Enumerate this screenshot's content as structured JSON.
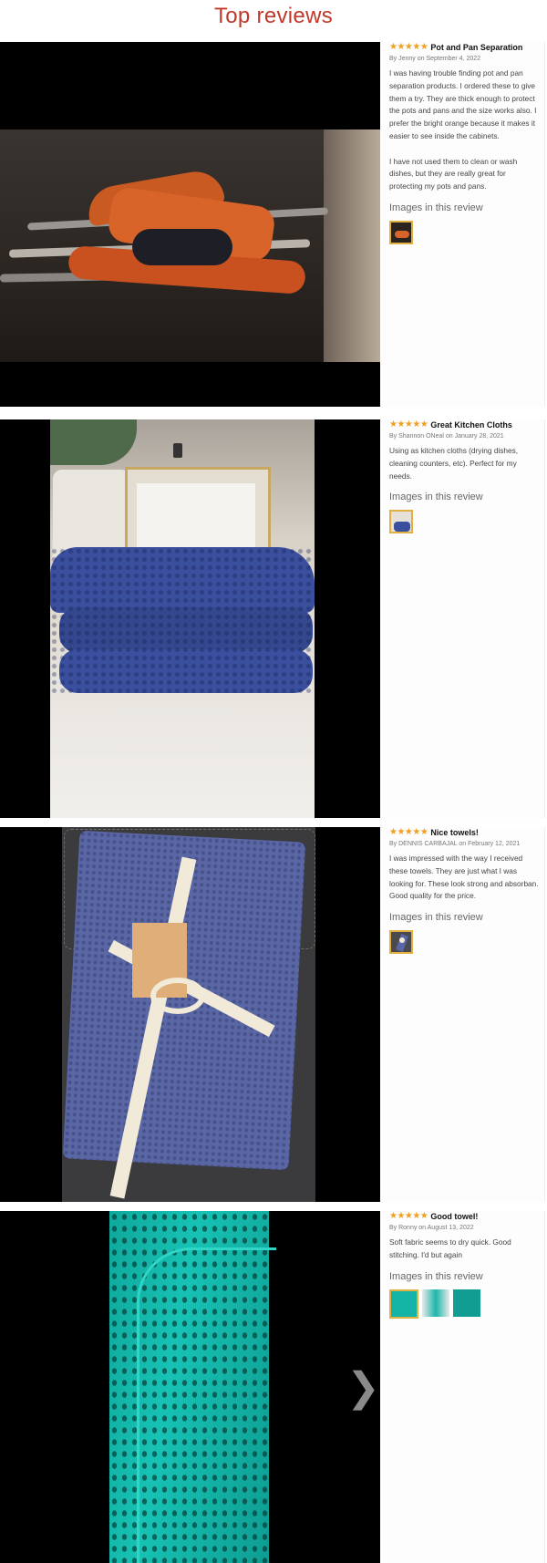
{
  "page": {
    "title": "Top reviews"
  },
  "labels": {
    "images_heading": "Images in this review"
  },
  "reviews": [
    {
      "stars": "★★★★★",
      "rating": 5,
      "title": "Pot and Pan Separation",
      "byline": "By Jenny on September 4, 2022",
      "text": "I was having trouble finding pot and pan separation products. I ordered these to give them a try. They are thick enough to protect the pots and pans and the size works also. I prefer the bright orange because it makes it easier to see inside the cabinets.\n\nI have not used them to clean or wash dishes, but they are really great for protecting my pots and pans."
    },
    {
      "stars": "★★★★★",
      "rating": 5,
      "title": "Great Kitchen Cloths",
      "byline": "By Shannon ONeal on January 28, 2021",
      "text": "Using as kitchen cloths (drying dishes, cleaning counters, etc). Perfect for my needs."
    },
    {
      "stars": "★★★★★",
      "rating": 5,
      "title": "Nice towels!",
      "byline": "By DENNIS CARBAJAL on February 12, 2021",
      "text": "I was impressed with the way I received these towels. They are just what I was looking for. These look strong and absorban. Good quality for the price."
    },
    {
      "stars": "★★★★★",
      "rating": 5,
      "title": "Good towel!",
      "byline": "By Ronny on August 13, 2022",
      "text": "Soft fabric seems to dry quick. Good stitching. I'd but again"
    }
  ],
  "colors": {
    "title": "#c0392b",
    "stars": "#f0a020",
    "thumb_border": "#e2b040"
  },
  "icons": {
    "next": "chevron-right-icon"
  }
}
